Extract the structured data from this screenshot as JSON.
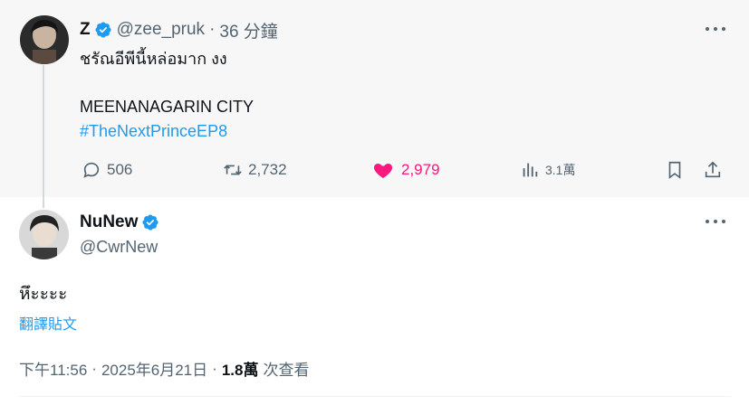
{
  "parent_tweet": {
    "display_name": "Z",
    "handle": "@zee_pruk",
    "separator": "·",
    "time_ago": "36 分鐘",
    "text_line1": "ชรัณอีพีนี้หล่อมาก งง",
    "text_line2": "MEENANAGARIN CITY",
    "hashtag": "#TheNextPrinceEP8",
    "replies": "506",
    "retweets": "2,732",
    "likes": "2,979",
    "views": "3.1萬"
  },
  "reply_tweet": {
    "display_name": "NuNew",
    "handle": "@CwrNew",
    "text": "หึะะะะ",
    "translate_label": "翻譯貼文",
    "time": "下午11:56",
    "separator": "·",
    "date": "2025年6月21日",
    "separator2": "·",
    "views_count": "1.8萬",
    "views_label": "次查看"
  },
  "colors": {
    "accent": "#1d9bf0",
    "like": "#f91880",
    "muted": "#536471",
    "parent_bg": "#f7f7f7"
  },
  "icons": [
    "verified-badge-icon",
    "more-icon",
    "reply-icon",
    "retweet-icon",
    "heart-icon",
    "views-icon",
    "bookmark-icon",
    "share-icon"
  ]
}
